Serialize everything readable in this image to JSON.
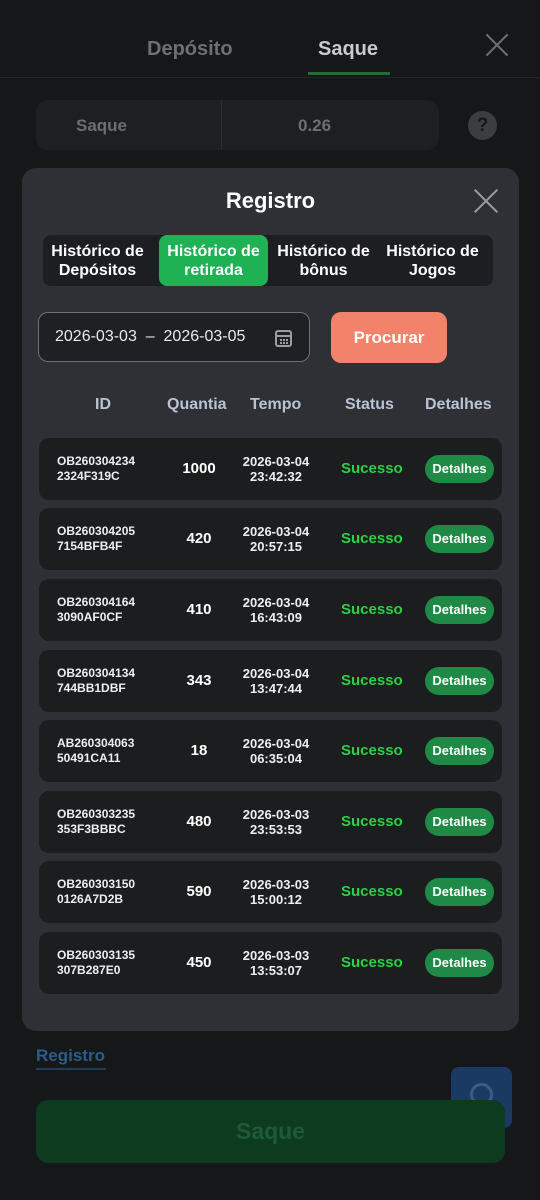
{
  "background": {
    "tabs": {
      "deposit": "Depósito",
      "withdraw": "Saque"
    },
    "amount_label": "Saque",
    "amount_value": "0.26",
    "help": "?",
    "registro_link": "Registro",
    "saque_button": "Saque"
  },
  "modal": {
    "title": "Registro",
    "tabs": [
      {
        "label": "Histórico de\nDepósitos",
        "active": false
      },
      {
        "label": "Histórico de\nretirada",
        "active": true
      },
      {
        "label": "Histórico de\nbônus",
        "active": false
      },
      {
        "label": "Histórico de\nJogos",
        "active": false
      }
    ],
    "date_range": "2026-03-03  –  2026-03-05",
    "search_button": "Procurar",
    "columns": {
      "id": "ID",
      "qty": "Quantia",
      "time": "Tempo",
      "status": "Status",
      "details": "Detalhes"
    },
    "rows": [
      {
        "id1": "OB260304234",
        "id2": "2324F319C",
        "qty": "1000",
        "date": "2026-03-04",
        "time": "23:42:32",
        "status": "Sucesso",
        "btn": "Detalhes"
      },
      {
        "id1": "OB260304205",
        "id2": "7154BFB4F",
        "qty": "420",
        "date": "2026-03-04",
        "time": "20:57:15",
        "status": "Sucesso",
        "btn": "Detalhes"
      },
      {
        "id1": "OB260304164",
        "id2": "3090AF0CF",
        "qty": "410",
        "date": "2026-03-04",
        "time": "16:43:09",
        "status": "Sucesso",
        "btn": "Detalhes"
      },
      {
        "id1": "OB260304134",
        "id2": "744BB1DBF",
        "qty": "343",
        "date": "2026-03-04",
        "time": "13:47:44",
        "status": "Sucesso",
        "btn": "Detalhes"
      },
      {
        "id1": "AB260304063",
        "id2": "50491CA11",
        "qty": "18",
        "date": "2026-03-04",
        "time": "06:35:04",
        "status": "Sucesso",
        "btn": "Detalhes"
      },
      {
        "id1": "OB260303235",
        "id2": "353F3BBBC",
        "qty": "480",
        "date": "2026-03-03",
        "time": "23:53:53",
        "status": "Sucesso",
        "btn": "Detalhes"
      },
      {
        "id1": "OB260303150",
        "id2": "0126A7D2B",
        "qty": "590",
        "date": "2026-03-03",
        "time": "15:00:12",
        "status": "Sucesso",
        "btn": "Detalhes"
      },
      {
        "id1": "OB260303135",
        "id2": "307B287E0",
        "qty": "450",
        "date": "2026-03-03",
        "time": "13:53:07",
        "status": "Sucesso",
        "btn": "Detalhes"
      }
    ]
  },
  "colors": {
    "accent_green": "#1fb255",
    "status_green": "#26d342",
    "search_orange": "#f3826a"
  }
}
